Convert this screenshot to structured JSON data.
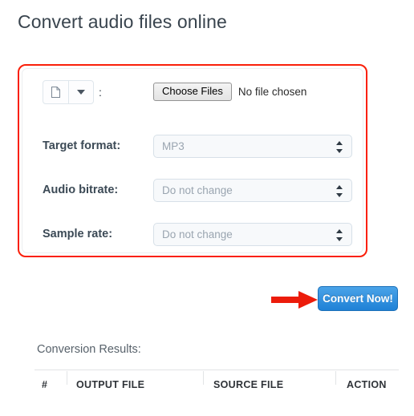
{
  "page": {
    "title": "Convert audio files online"
  },
  "form": {
    "file_type_button": {
      "icon": "document-icon",
      "dropdown_icon": "chevron-down-icon"
    },
    "separator": ":",
    "file_input": {
      "button_label": "Choose Files",
      "status": "No file chosen"
    },
    "fields": [
      {
        "label": "Target format:",
        "value": "MP3"
      },
      {
        "label": "Audio bitrate:",
        "value": "Do not change"
      },
      {
        "label": "Sample rate:",
        "value": "Do not change"
      }
    ]
  },
  "actions": {
    "convert_label": "Convert Now!",
    "annotation_arrow": "red-arrow-pointing-right"
  },
  "results": {
    "heading": "Conversion Results:",
    "columns": [
      "#",
      "OUTPUT FILE",
      "SOURCE FILE",
      "ACTION"
    ],
    "rows": []
  },
  "colors": {
    "annotation_red": "#fa1f09",
    "arrow_red": "#ec1c0b",
    "button_blue_top": "#4aa3e8",
    "button_blue_bottom": "#1f81d6",
    "title_text": "#39444e"
  }
}
